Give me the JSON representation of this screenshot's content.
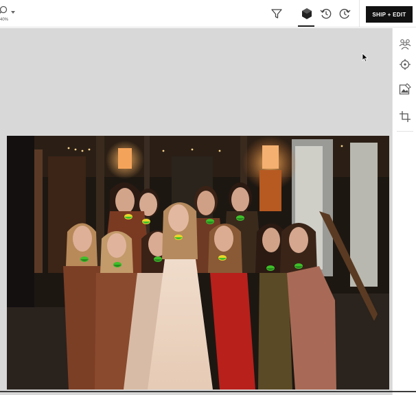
{
  "toolbar": {
    "zoom_label": "40%",
    "ship_button_label": "SHIP + EDIT"
  },
  "icons": {
    "zoom": "zoom-icon",
    "filter": "filter-icon",
    "layers": "layers-icon",
    "history_back": "history-icon",
    "history_forward": "history-forward-icon",
    "people": "people-icon",
    "target": "target-icon",
    "image_edit": "image-edit-icon",
    "crop": "crop-icon"
  },
  "colors": {
    "face_marker_green": "#3fbf2a",
    "face_marker_yellow": "#e8d62a",
    "ship_button_bg": "#111111",
    "canvas_bg": "#d8d8d8"
  }
}
